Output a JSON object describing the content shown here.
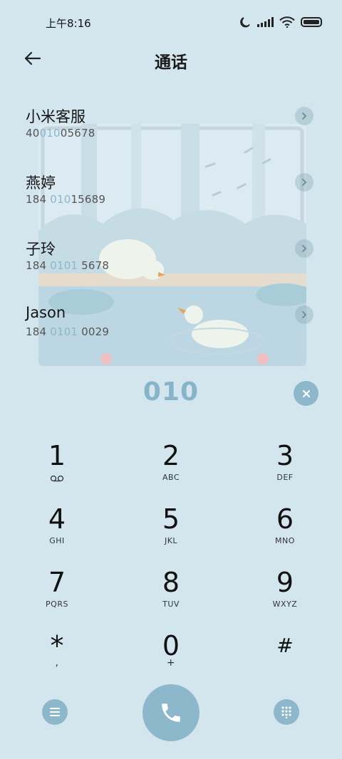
{
  "status_bar": {
    "time": "上午8:16"
  },
  "header": {
    "title": "通话"
  },
  "contacts": [
    {
      "name": "小米客服",
      "num_pre": "40",
      "num_match": "010",
      "num_post": "05678"
    },
    {
      "name": "燕婷",
      "num_pre": "184 ",
      "num_match": "010",
      "num_post": "15689"
    },
    {
      "name": "子玲",
      "num_pre": "184 ",
      "num_match": "0101",
      "num_post": " 5678"
    },
    {
      "name": "Jason",
      "num_pre": "184 ",
      "num_match": "0101",
      "num_post": " 0029"
    }
  ],
  "dialer": {
    "input": "010"
  },
  "keypad": [
    {
      "digit": "1",
      "letters": ""
    },
    {
      "digit": "2",
      "letters": "ABC"
    },
    {
      "digit": "3",
      "letters": "DEF"
    },
    {
      "digit": "4",
      "letters": "GHI"
    },
    {
      "digit": "5",
      "letters": "JKL"
    },
    {
      "digit": "6",
      "letters": "MNO"
    },
    {
      "digit": "7",
      "letters": "PQRS"
    },
    {
      "digit": "8",
      "letters": "TUV"
    },
    {
      "digit": "9",
      "letters": "WXYZ"
    },
    {
      "digit": "*",
      "letters": ","
    },
    {
      "digit": "0",
      "letters": "+"
    },
    {
      "digit": "#",
      "letters": ""
    }
  ],
  "colors": {
    "background": "#d3e6ee",
    "accent": "#8db7cb",
    "highlight": "#89b8cc"
  },
  "icons": {
    "back": "arrow-left-icon",
    "chevron": "chevron-right-icon",
    "clear": "close-icon",
    "voicemail": "voicemail-icon",
    "menu": "menu-icon",
    "call": "phone-icon",
    "dialpad": "dialpad-icon"
  }
}
